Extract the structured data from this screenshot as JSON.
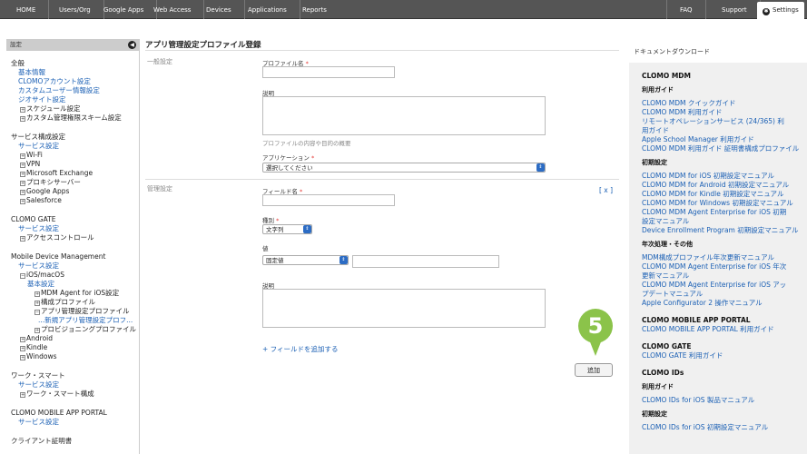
{
  "nav": {
    "items": [
      "HOME",
      "Users/Org",
      "Google Apps",
      "Web Access",
      "Devices",
      "Applications",
      "Reports"
    ],
    "faq": "FAQ",
    "support": "Support",
    "settings": "Settings"
  },
  "sidebar": {
    "header": "設定",
    "general": {
      "title": "全般",
      "links": [
        "基本情報",
        "CLOMOアカウント設定",
        "カスタムユーザー情報設定",
        "ジオサイト設定"
      ],
      "trees": [
        "スケジュール設定",
        "カスタム管理権限スキーム設定"
      ]
    },
    "service": {
      "title": "サービス構成設定",
      "link": "サービス設定",
      "trees": [
        "Wi-Fi",
        "VPN",
        "Microsoft Exchange",
        "プロキシサーバー",
        "Google Apps",
        "Salesforce"
      ]
    },
    "gate": {
      "title": "CLOMO GATE",
      "link": "サービス設定",
      "tree": "アクセスコントロール"
    },
    "mdm": {
      "title": "Mobile Device Management",
      "link": "サービス設定",
      "ios": "iOS/macOS",
      "basic": "基本設定",
      "agent": "MDM Agent for iOS設定",
      "profile": "構成プロファイル",
      "app_profile": "アプリ管理設定プロファイル",
      "new_app_profile": "...新規アプリ管理設定プロフ...",
      "provisioning": "プロビジョニングプロファイル",
      "android": "Android",
      "kindle": "Kindle",
      "windows": "Windows"
    },
    "ws": {
      "title": "ワーク・スマート",
      "link": "サービス設定",
      "tree": "ワーク・スマート構成"
    },
    "portal": {
      "title": "CLOMO MOBILE APP PORTAL",
      "link": "サービス設定"
    },
    "cert": {
      "title": "クライアント証明書"
    }
  },
  "main": {
    "title": "アプリ管理設定プロファイル登録",
    "general_label": "一般設定",
    "profile_name_label": "プロファイル名",
    "description_label": "説明",
    "description_help": "プロファイルの内容や目的の概要",
    "application_label": "アプリケーション",
    "application_value": "選択してください",
    "manage_label": "管理設定",
    "field_name_label": "フィールド名",
    "close": "[ x ]",
    "type_label": "種別",
    "type_value": "文字列",
    "value_label": "値",
    "value_type": "固定値",
    "desc2_label": "説明",
    "add_field": "+ フィールドを追加する",
    "add_button": "追加",
    "required_mark": "*",
    "step_number": "5"
  },
  "right": {
    "title": "ドキュメントダウンロード",
    "mdm_title": "CLOMO MDM",
    "usage_guide": "利用ガイド",
    "usage_links": [
      "CLOMO MDM クイックガイド",
      "CLOMO MDM 利用ガイド",
      "リモートオペレーションサービス (24/365) 利",
      "用ガイド",
      "Apple School Manager 利用ガイド",
      "CLOMO MDM 利用ガイド 証明書構成プロファイル"
    ],
    "initial_title": "初期設定",
    "initial_links": [
      "CLOMO MDM for iOS 初期設定マニュアル",
      "CLOMO MDM for Android 初期設定マニュアル",
      "CLOMO MDM for Kindle 初期設定マニュアル",
      "CLOMO MDM for Windows 初期設定マニュアル",
      "CLOMO MDM Agent Enterprise for iOS 初期",
      "設定マニュアル",
      "Device Enrollment Program 初期設定マニュアル"
    ],
    "annual_title": "年次処理・その他",
    "annual_links": [
      "MDM構成プロファイル年次更新マニュアル",
      "CLOMO MDM Agent Enterprise for iOS 年次",
      "更新マニュアル",
      "CLOMO MDM Agent Enterprise for iOS アッ",
      "プデートマニュアル",
      "Apple Configurator 2 操作マニュアル"
    ],
    "portal_title": "CLOMO MOBILE APP PORTAL",
    "portal_link": "CLOMO MOBILE APP PORTAL 利用ガイド",
    "gate_title": "CLOMO GATE",
    "gate_link": "CLOMO GATE 利用ガイド",
    "ids_title": "CLOMO IDs",
    "ids_usage": "利用ガイド",
    "ids_link": "CLOMO IDs for iOS 製品マニュアル",
    "ids_initial": "初期設定",
    "ids_initial_link": "CLOMO IDs for iOS 初期設定マニュアル"
  },
  "colors": {
    "accent": "#8bc34a",
    "link": "#1a5fb4",
    "nav_bg": "#555555"
  }
}
